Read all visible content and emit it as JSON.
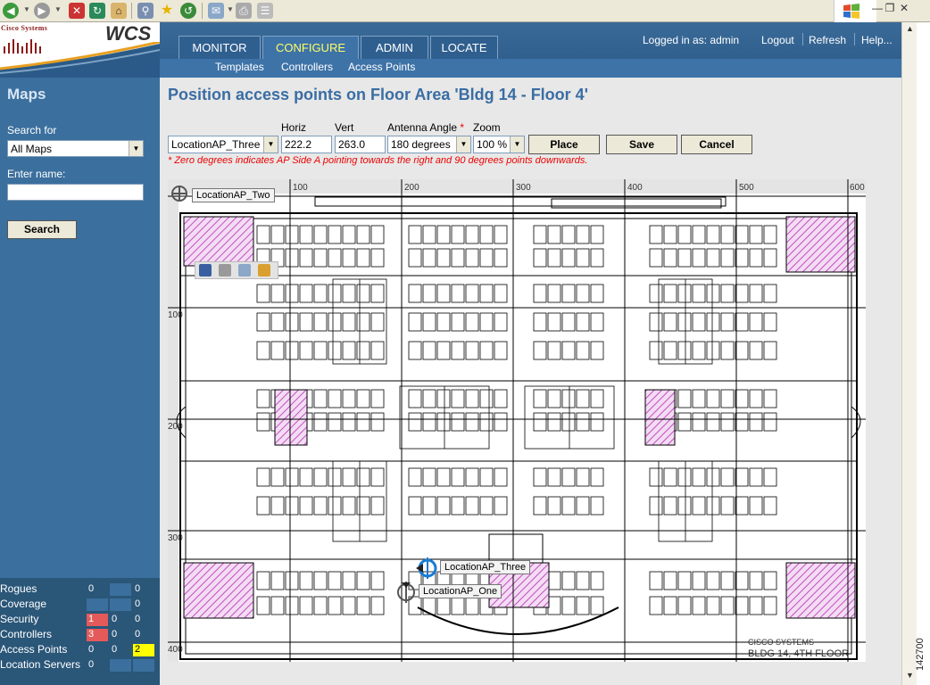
{
  "header": {
    "logo_company": "Cisco Systems",
    "logo_product": "WCS",
    "tabs": [
      {
        "label": "MONITOR",
        "active": false
      },
      {
        "label": "CONFIGURE",
        "active": true
      },
      {
        "label": "ADMIN",
        "active": false
      },
      {
        "label": "LOCATE",
        "active": false
      }
    ],
    "logged_in": "Logged in as: admin",
    "links": [
      "Logout",
      "Refresh",
      "Help..."
    ],
    "subnav": [
      "Templates",
      "Controllers",
      "Access Points"
    ]
  },
  "sidebar": {
    "title": "Maps",
    "search_for_label": "Search for",
    "search_for_value": "All Maps",
    "enter_name_label": "Enter name:",
    "enter_name_value": "",
    "search_button": "Search"
  },
  "alarms": {
    "rows": [
      {
        "name": "Rogues",
        "critical": "0",
        "major": "",
        "minor": "0"
      },
      {
        "name": "Coverage",
        "critical": "",
        "major": "",
        "minor": "0"
      },
      {
        "name": "Security",
        "critical": "1",
        "major": "0",
        "minor": "0"
      },
      {
        "name": "Controllers",
        "critical": "3",
        "major": "0",
        "minor": "0"
      },
      {
        "name": "Access Points",
        "critical": "0",
        "major": "0",
        "minor": "2"
      },
      {
        "name": "Location Servers",
        "critical": "0",
        "major": "",
        "minor": ""
      }
    ],
    "colors": {
      "critical": "#e45a5a",
      "minor": "#ffff00"
    }
  },
  "main": {
    "title": "Position access points on Floor Area 'Bldg 14 - Floor 4'",
    "ap_select": "LocationAP_Three",
    "horiz_label": "Horiz",
    "horiz_value": "222.2",
    "vert_label": "Vert",
    "vert_value": "263.0",
    "antenna_label": "Antenna Angle",
    "antenna_required": "*",
    "antenna_value": "180 degrees",
    "zoom_label": "Zoom",
    "zoom_value": "100 %",
    "buttons": {
      "place": "Place",
      "save": "Save",
      "cancel": "Cancel"
    },
    "note": "* Zero degrees indicates AP Side A pointing towards the right and 90 degrees points downwards."
  },
  "map": {
    "x_ticks": [
      "100",
      "200",
      "300",
      "400",
      "500",
      "600"
    ],
    "y_ticks": [
      "100",
      "200",
      "300",
      "400"
    ],
    "access_points": [
      "LocationAP_Two",
      "LocationAP_Three",
      "LocationAP_One"
    ],
    "footer_company": "CISCO SYSTEMS",
    "footer_floor": "BLDG 14, 4TH FLOOR"
  },
  "figure_id": "142700",
  "colors": {
    "accent": "#3a6da3",
    "sidebar": "#3b6f9d",
    "active_tab": "#ffff66",
    "hatch": "#cc66cc"
  }
}
